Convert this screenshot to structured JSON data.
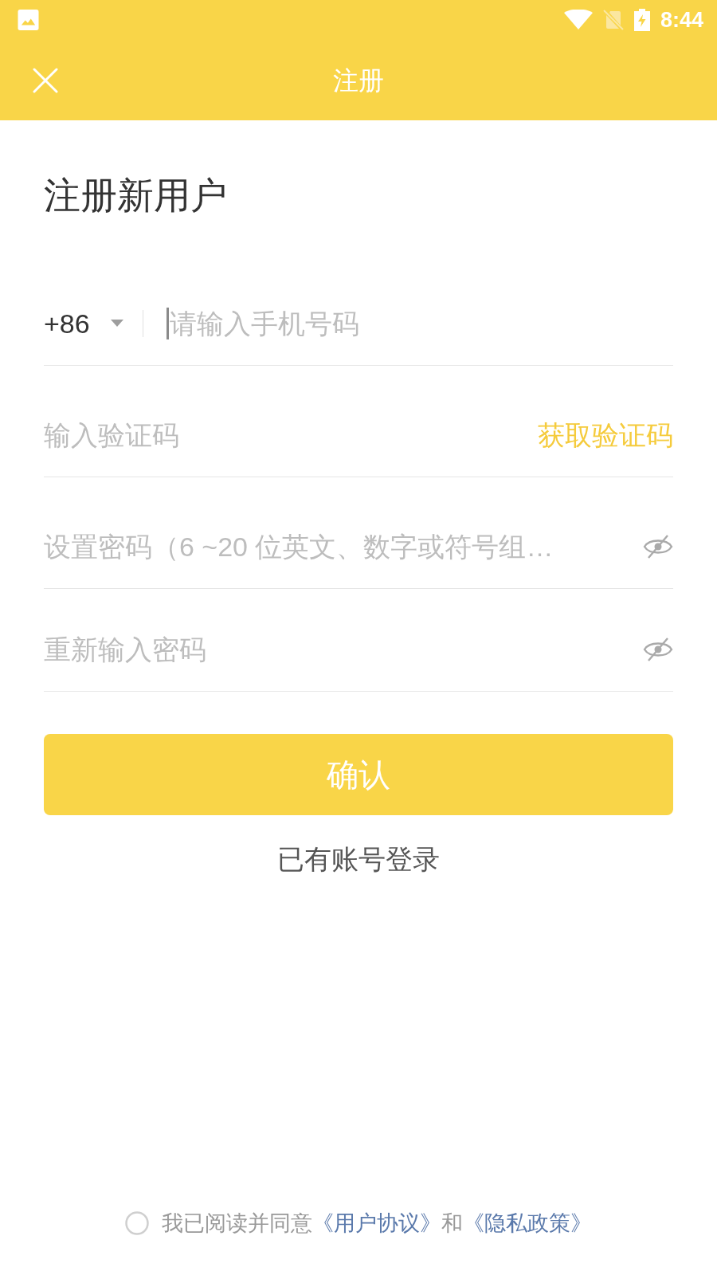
{
  "status_bar": {
    "time": "8:44"
  },
  "app_bar": {
    "title": "注册"
  },
  "heading": "注册新用户",
  "fields": [
    {
      "kind": "phone",
      "country_code": "+86",
      "placeholder": "请输入手机号码",
      "focused": true
    },
    {
      "kind": "code",
      "placeholder": "输入验证码",
      "action": "获取验证码",
      "focused": false
    },
    {
      "kind": "password",
      "placeholder": "设置密码（6 ~20 位英文、数字或符号组…",
      "password_visible": false,
      "focused": false
    },
    {
      "kind": "password",
      "placeholder": "重新输入密码",
      "password_visible": false,
      "focused": false
    }
  ],
  "confirm_button": "确认",
  "login_link": "已有账号登录",
  "agreement": {
    "checked": false,
    "segments": [
      {
        "kind": "plain",
        "text": "我已阅读并同意"
      },
      {
        "kind": "link",
        "text": "《用户协议》"
      },
      {
        "kind": "plain",
        "text": "和"
      },
      {
        "kind": "link",
        "text": "《隐私政策》"
      }
    ]
  }
}
